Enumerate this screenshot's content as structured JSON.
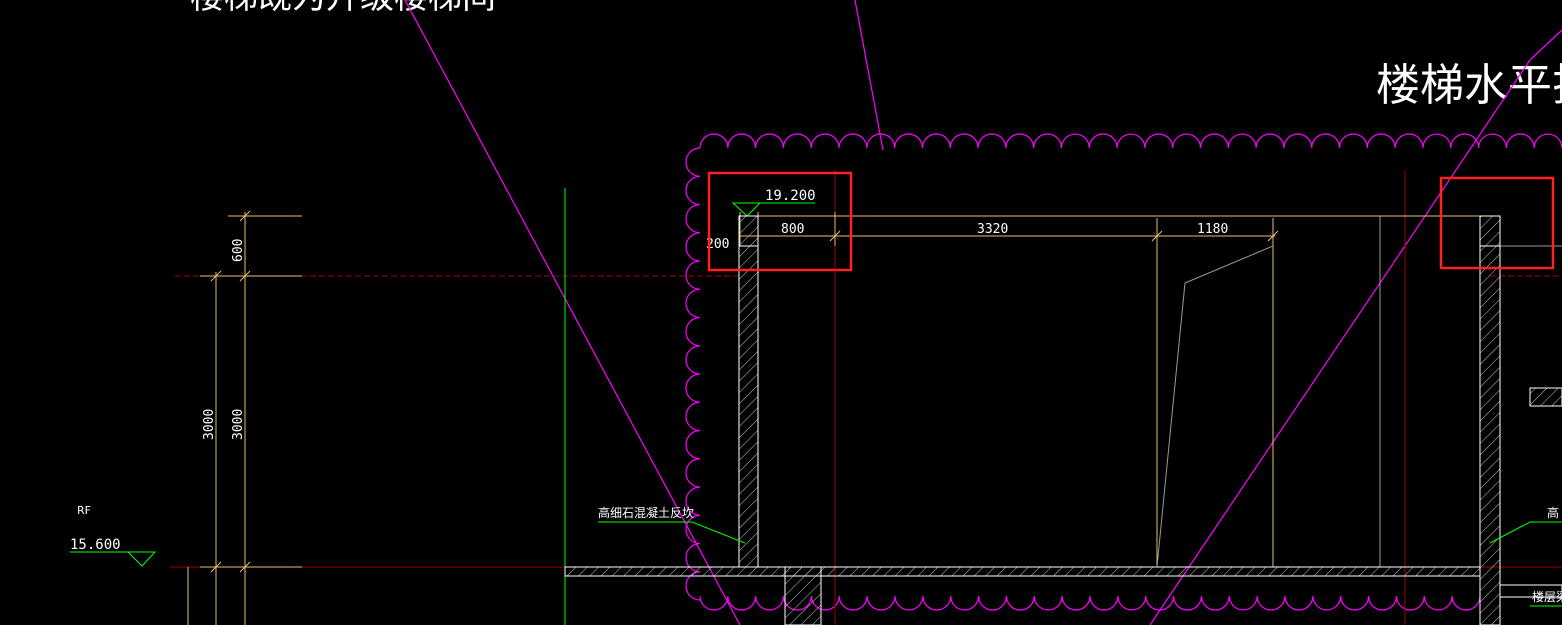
{
  "drawing": {
    "title_top_left": "楼梯既为升级楼梯间",
    "title_top_right": "楼梯水平扶",
    "level_roof": "RF",
    "level_roof_elev": "15.600",
    "level_top_elev": "19.200",
    "dims_vertical": [
      "600",
      "3000",
      "3000"
    ],
    "dims_horizontal": [
      "800",
      "3320",
      "1180"
    ],
    "dim_wall": "200",
    "note_left": "高细石混凝土反坎",
    "note_right": "高",
    "note_floor_right": "楼层梁"
  },
  "colors": {
    "background": "#000000",
    "magenta": "#ff00ff",
    "yellow_dim": "#e8c070",
    "green": "#00ff00",
    "red_axis": "#a00000",
    "white": "#ffffff",
    "highlight": "#ff2020"
  }
}
